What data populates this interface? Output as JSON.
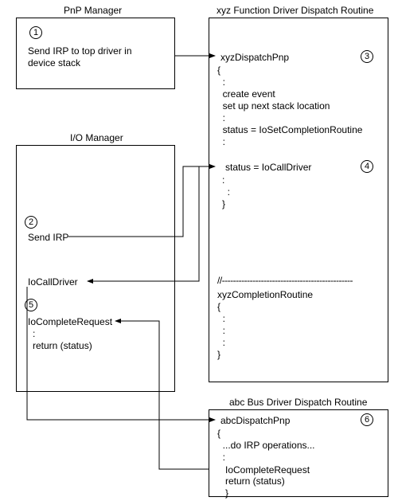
{
  "pnp": {
    "title": "PnP Manager",
    "step": "1",
    "text": "Send IRP to top driver in\ndevice stack"
  },
  "io": {
    "title": "I/O Manager",
    "step": "2",
    "send": "Send IRP",
    "iocall": "IoCallDriver",
    "step5": "5",
    "iocomp": "IoCompleteRequest",
    "ret": "return (status)"
  },
  "func": {
    "title": "xyz Function Driver Dispatch Routine",
    "fn": "xyzDispatchPnp",
    "step3": "3",
    "body1": "{\n  :\n  create event\n  set up next stack location\n  :\n  status = IoSetCompletionRoutine\n  :",
    "iocall": "status = IoCallDriver",
    "step4": "4",
    "body2": ":\n  :\n}",
    "rule": "//-----------------------------------------------",
    "completion": "xyzCompletionRoutine\n{\n  :\n  :\n  :\n}"
  },
  "bus": {
    "title": "abc Bus Driver Dispatch Routine",
    "fn": "abcDispatchPnp",
    "step6": "6",
    "body": "{\n  ...do IRP operations...\n  :",
    "iocomp": "IoCompleteRequest",
    "ret": "return (status)\n}"
  }
}
